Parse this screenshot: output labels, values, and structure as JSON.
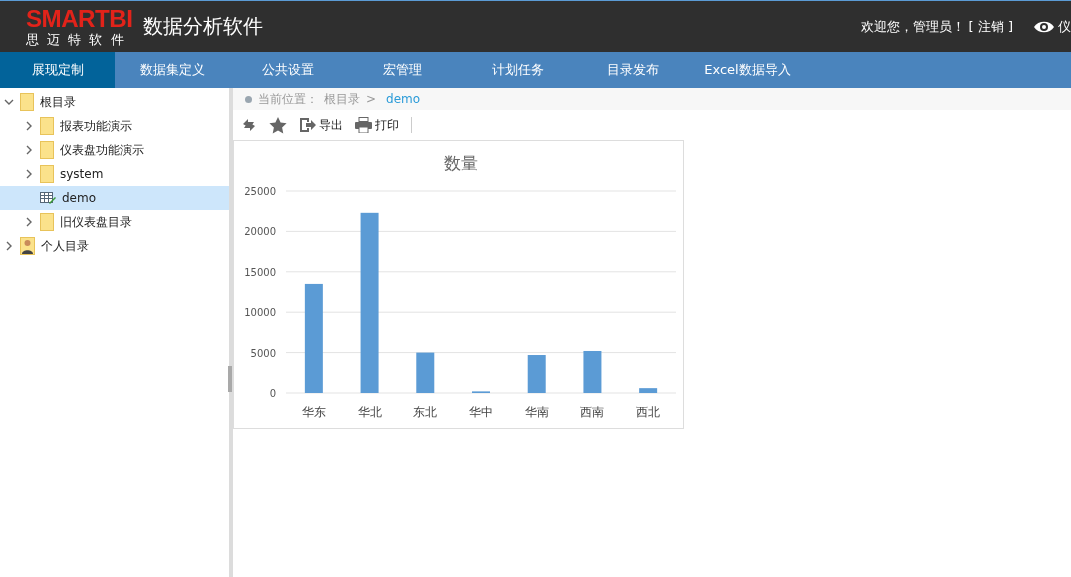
{
  "header": {
    "logo": {
      "brand": "SMARTBI",
      "subtitle": "思 迈 特 软 件"
    },
    "title": "数据分析软件",
    "welcome": "欢迎您，管理员！",
    "logout": "[ 注销 ]",
    "view_link": "仪"
  },
  "nav": [
    {
      "label": "展现定制",
      "selected": true
    },
    {
      "label": "数据集定义",
      "selected": false
    },
    {
      "label": "公共设置",
      "selected": false
    },
    {
      "label": "宏管理",
      "selected": false
    },
    {
      "label": "计划任务",
      "selected": false
    },
    {
      "label": "目录发布",
      "selected": false
    },
    {
      "label": "Excel数据导入",
      "selected": false
    }
  ],
  "tree": [
    {
      "label": "根目录",
      "kind": "folder",
      "expanded": true,
      "selected": false,
      "children": [
        {
          "label": "报表功能演示",
          "kind": "folder",
          "expanded": false,
          "selected": false
        },
        {
          "label": "仪表盘功能演示",
          "kind": "folder",
          "expanded": false,
          "selected": false
        },
        {
          "label": "system",
          "kind": "folder",
          "expanded": false,
          "selected": false
        },
        {
          "label": "demo",
          "kind": "report",
          "selected": true
        },
        {
          "label": "旧仪表盘目录",
          "kind": "folder",
          "expanded": false,
          "selected": false
        }
      ]
    },
    {
      "label": "个人目录",
      "kind": "user",
      "expanded": false,
      "selected": false
    }
  ],
  "breadcrumb": {
    "label": "当前位置：",
    "path": [
      "根目录"
    ],
    "separator": ">",
    "current": "demo"
  },
  "toolbar": [
    {
      "kind": "refresh"
    },
    {
      "kind": "favorite"
    },
    {
      "kind": "export",
      "label": "导出"
    },
    {
      "kind": "print",
      "label": "打印"
    }
  ],
  "chart": {
    "chart_data": {
      "type": "bar",
      "title": "数量",
      "categories": [
        "华东",
        "华北",
        "东北",
        "华中",
        "华南",
        "西南",
        "西北"
      ],
      "values": [
        13500,
        22300,
        5000,
        200,
        4700,
        5200,
        600
      ],
      "grid": true,
      "ylim": [
        0,
        25000
      ],
      "yticks": [
        0,
        5000,
        10000,
        15000,
        20000,
        25000
      ]
    }
  }
}
